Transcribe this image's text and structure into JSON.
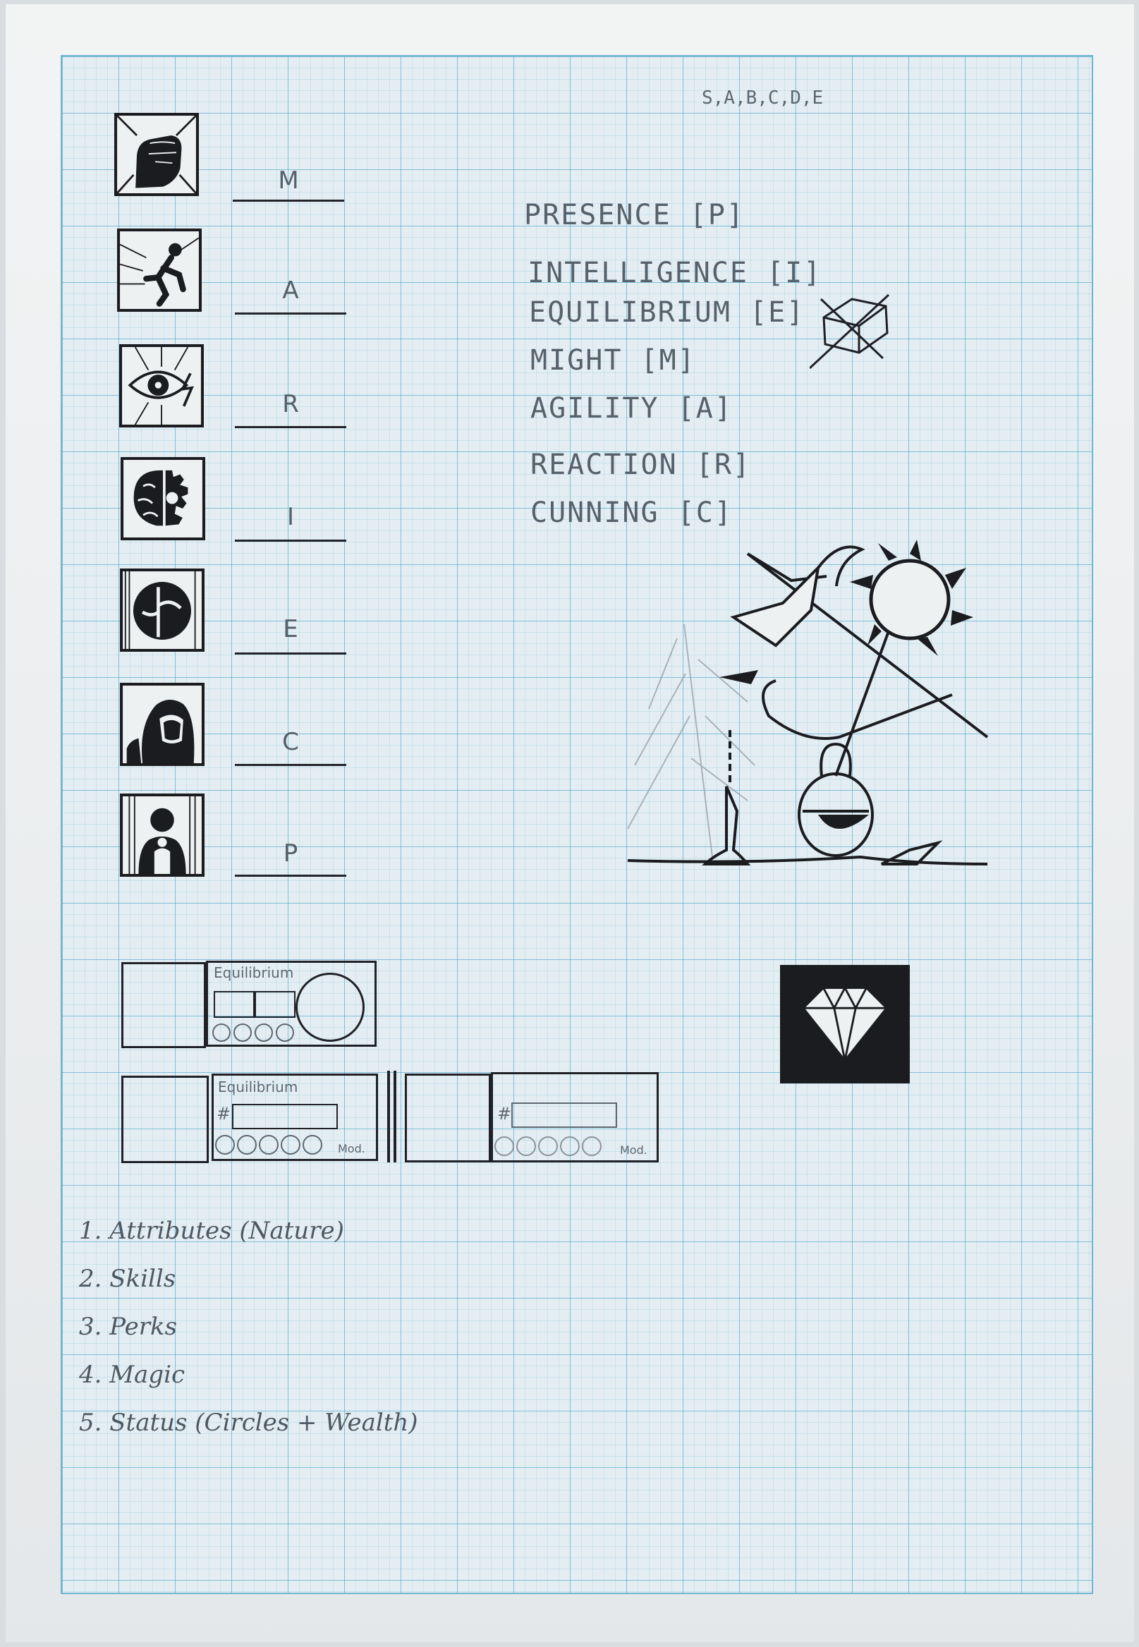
{
  "grades": "S,A,B,C,D,E",
  "slots": [
    {
      "letter": "M",
      "icon": "fist-icon"
    },
    {
      "letter": "A",
      "icon": "running-figure-icon"
    },
    {
      "letter": "R",
      "icon": "eye-lightning-icon"
    },
    {
      "letter": "I",
      "icon": "brain-gear-icon"
    },
    {
      "letter": "E",
      "icon": "balance-symbol-icon"
    },
    {
      "letter": "C",
      "icon": "hooded-figure-icon"
    },
    {
      "letter": "P",
      "icon": "radiant-person-icon"
    }
  ],
  "attributes": [
    "PRESENCE [P]",
    "INTELLIGENCE [I]",
    "EQUILIBRIUM [E]",
    "MIGHT [M]",
    "AGILITY [A]",
    "REACTION [R]",
    "CUNNING [C]"
  ],
  "widgets": {
    "top_label": "Equilibrium",
    "bottom_label": "Equilibrium",
    "hash": "#",
    "mod": "Mod.",
    "hash2": "#",
    "mod2": "Mod."
  },
  "sections": [
    "1. Attributes   (Nature)",
    "2. Skills",
    "3. Perks",
    "4. Magic",
    "5. Status  (Circles + Wealth)"
  ],
  "colors": {
    "ink": "#1b1c20",
    "pencil": "#56616b",
    "grid": "#46a0c8"
  }
}
